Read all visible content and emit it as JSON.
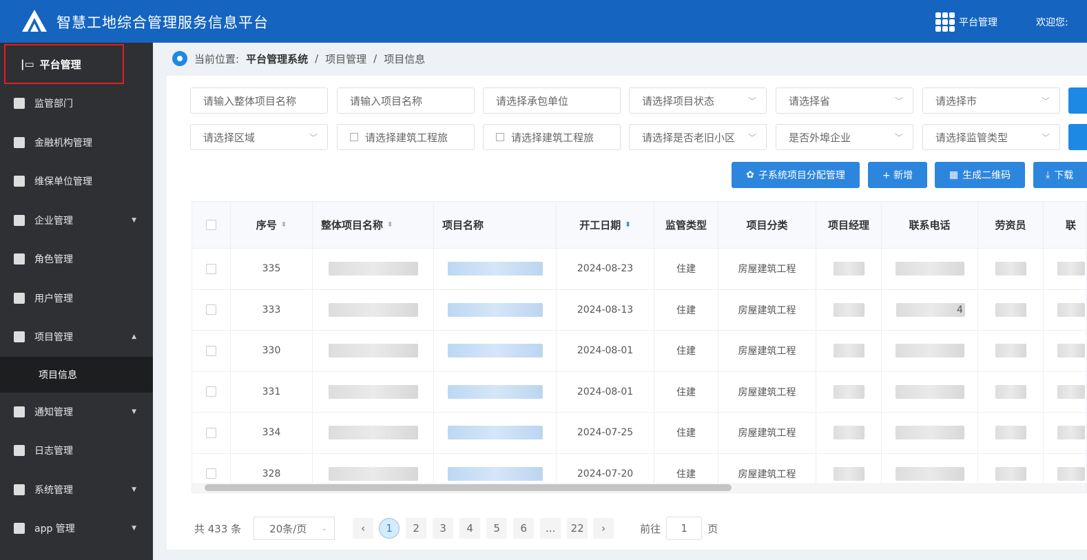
{
  "header": {
    "title": "智慧工地综合管理服务信息平台",
    "platform_label": "平台管理",
    "welcome": "欢迎您:",
    "logo": "triangle-logo"
  },
  "sidebar": {
    "head": "平台管理",
    "items": [
      {
        "label": "监管部门",
        "icon": "building-icon"
      },
      {
        "label": "金融机构管理",
        "icon": "moneybag-icon"
      },
      {
        "label": "维保单位管理",
        "icon": "building-icon"
      },
      {
        "label": "企业管理",
        "icon": "building-icon",
        "caret": "▼"
      },
      {
        "label": "角色管理",
        "icon": "group-icon"
      },
      {
        "label": "用户管理",
        "icon": "user-icon"
      },
      {
        "label": "项目管理",
        "icon": "folder-icon",
        "caret": "▲"
      }
    ],
    "sub": "项目信息",
    "items2": [
      {
        "label": "通知管理",
        "icon": "bell-icon",
        "caret": "▼"
      },
      {
        "label": "日志管理",
        "icon": "log-icon"
      },
      {
        "label": "系统管理",
        "icon": "monitor-icon",
        "caret": "▼"
      },
      {
        "label": "app 管理",
        "icon": "apps-icon",
        "caret": "▼"
      }
    ]
  },
  "breadcrumb": {
    "prefix": "当前位置:",
    "items": [
      "平台管理系统",
      "项目管理",
      "项目信息"
    ],
    "sep": "/"
  },
  "filters": {
    "row1": [
      "请输入整体项目名称",
      "请输入项目名称",
      "请选择承包单位",
      "请选择项目状态",
      "请选择省",
      "请选择市"
    ],
    "row2": [
      "请选择区域",
      "请选择建筑工程旅",
      "请选择建筑工程旅",
      "请选择是否老旧小区",
      "是否外埠企业",
      "请选择监管类型"
    ]
  },
  "actions": [
    "子系统项目分配管理",
    "+ 新增",
    "生成二维码",
    "下载"
  ],
  "table": {
    "headers": [
      "序号",
      "整体项目名称",
      "项目名称",
      "开工日期",
      "监管类型",
      "项目分类",
      "项目经理",
      "联系电话",
      "劳资员",
      "联"
    ],
    "rows": [
      {
        "seq": "335",
        "date": "2024-08-23",
        "type": "住建",
        "category": "房屋建筑工程",
        "phone_suffix": ""
      },
      {
        "seq": "333",
        "date": "2024-08-13",
        "type": "住建",
        "category": "房屋建筑工程",
        "phone_suffix": "4"
      },
      {
        "seq": "330",
        "date": "2024-08-01",
        "type": "住建",
        "category": "房屋建筑工程",
        "phone_suffix": ""
      },
      {
        "seq": "331",
        "date": "2024-08-01",
        "type": "住建",
        "category": "房屋建筑工程",
        "phone_suffix": ""
      },
      {
        "seq": "334",
        "date": "2024-07-25",
        "type": "住建",
        "category": "房屋建筑工程",
        "phone_suffix": ""
      },
      {
        "seq": "328",
        "date": "2024-07-20",
        "type": "住建",
        "category": "房屋建筑工程",
        "phone_suffix": ""
      }
    ]
  },
  "pagination": {
    "total": "共 433 条",
    "page_size": "20条/页",
    "pages": [
      "1",
      "2",
      "3",
      "4",
      "5",
      "6",
      "...",
      "22"
    ],
    "current": "1",
    "goto_label": "前往",
    "goto_value": "1",
    "goto_suffix": "页"
  },
  "colors": {
    "header": "#1565c0",
    "sidebar": "#2f3033",
    "accent": "#1e88e5"
  }
}
